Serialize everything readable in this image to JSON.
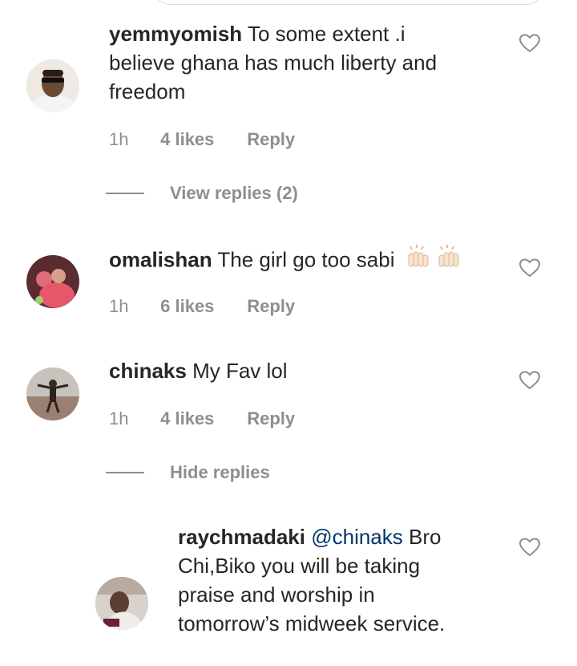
{
  "comments": [
    {
      "username": "yemmyomish",
      "text_lines": [
        "To some extent .i",
        "believe ghana has much liberty and",
        "freedom"
      ],
      "time": "1h",
      "likes": "4 likes",
      "reply": "Reply",
      "avatar": "person-with-sunglasses-avatar"
    },
    {
      "username": "omalishan",
      "text": "The girl go too sabi",
      "emoji": "raising-hands-emoji",
      "time": "1h",
      "likes": "6 likes",
      "reply": "Reply",
      "avatar": "woman-in-pink-avatar"
    },
    {
      "username": "chinaks",
      "text": "My Fav lol",
      "time": "1h",
      "likes": "4 likes",
      "reply": "Reply",
      "avatar": "man-on-beach-avatar"
    }
  ],
  "view_replies": "View replies (2)",
  "hide_replies": "Hide replies",
  "reply_comment": {
    "username": "raychmadaki",
    "mention": "@chinaks",
    "text_first": "Bro",
    "text_lines": [
      "Chi,Biko you will be taking",
      "praise and worship in",
      "tomorrow’s midweek service."
    ],
    "avatar": "woman-portrait-avatar"
  },
  "colors": {
    "text": "#262626",
    "meta": "#8e8e8e",
    "mention": "#003569",
    "divider": "#dbdbdb"
  },
  "icons": [
    "heart-outline-icon"
  ]
}
